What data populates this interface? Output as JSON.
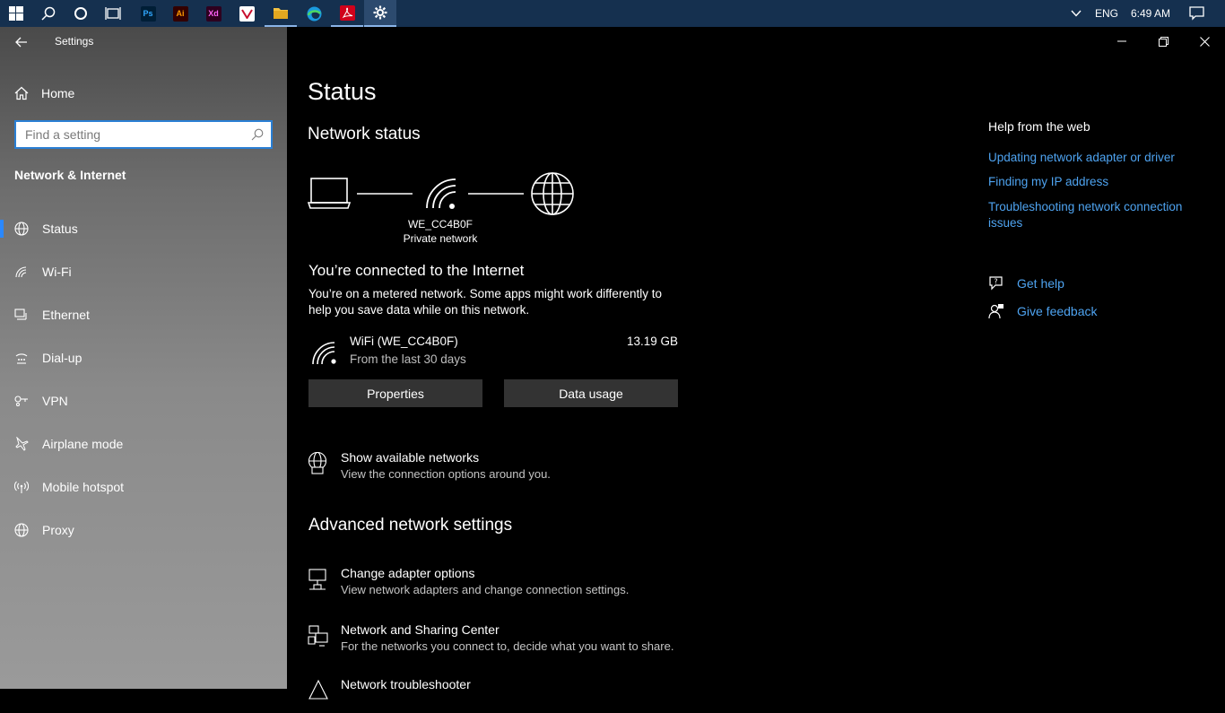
{
  "taskbar": {
    "apps": [
      {
        "name": "photoshop",
        "label": "Ps",
        "bg": "#001e36",
        "fg": "#31a8ff"
      },
      {
        "name": "illustrator",
        "label": "Ai",
        "bg": "#330000",
        "fg": "#ff9a00"
      },
      {
        "name": "xd",
        "label": "Xd",
        "bg": "#2e001f",
        "fg": "#ff61f6"
      }
    ],
    "tray": {
      "language": "ENG",
      "time": "6:49 AM"
    }
  },
  "sidebar": {
    "title": "Settings",
    "home_label": "Home",
    "search_placeholder": "Find a setting",
    "section": "Network & Internet",
    "items": [
      {
        "label": "Status",
        "icon": "globe-icon"
      },
      {
        "label": "Wi-Fi",
        "icon": "wifi-icon"
      },
      {
        "label": "Ethernet",
        "icon": "ethernet-icon"
      },
      {
        "label": "Dial-up",
        "icon": "dialup-icon"
      },
      {
        "label": "VPN",
        "icon": "vpn-icon"
      },
      {
        "label": "Airplane mode",
        "icon": "airplane-icon"
      },
      {
        "label": "Mobile hotspot",
        "icon": "hotspot-icon"
      },
      {
        "label": "Proxy",
        "icon": "globe-icon"
      }
    ]
  },
  "main": {
    "title": "Status",
    "network_status": "Network status",
    "network_name": "WE_CC4B0F",
    "network_type": "Private network",
    "connected_text": "You’re connected to the Internet",
    "metered_text": "You’re on a metered network. Some apps might work differently to help you save data while on this network.",
    "wifi": {
      "name": "WiFi (WE_CC4B0F)",
      "period": "From the last 30 days",
      "usage": "13.19 GB"
    },
    "buttons": {
      "properties": "Properties",
      "data_usage": "Data usage"
    },
    "show_networks": {
      "title": "Show available networks",
      "subtitle": "View the connection options around you."
    },
    "advanced_heading": "Advanced network settings",
    "advanced": [
      {
        "title": "Change adapter options",
        "subtitle": "View network adapters and change connection settings."
      },
      {
        "title": "Network and Sharing Center",
        "subtitle": "For the networks you connect to, decide what you want to share."
      },
      {
        "title": "Network troubleshooter",
        "subtitle": ""
      }
    ]
  },
  "help": {
    "title": "Help from the web",
    "links": [
      "Updating network adapter or driver",
      "Finding my IP address",
      "Troubleshooting network connection issues"
    ],
    "get_help": "Get help",
    "give_feedback": "Give feedback"
  },
  "colors": {
    "accent": "#2a88ff",
    "link": "#4ea3f0",
    "taskbar": "#15304f"
  }
}
